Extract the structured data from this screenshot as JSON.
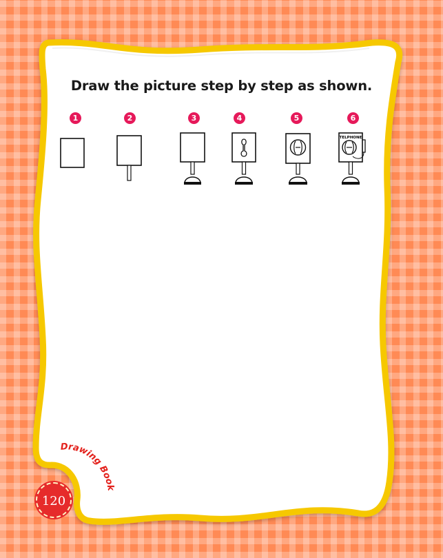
{
  "instruction": "Draw the picture step by step as shown.",
  "steps": [
    {
      "number": "1"
    },
    {
      "number": "2"
    },
    {
      "number": "3"
    },
    {
      "number": "4"
    },
    {
      "number": "5"
    },
    {
      "number": "6",
      "label": "TELPHONE"
    }
  ],
  "footer": {
    "brand": "Drawing Book",
    "page_number": "120"
  },
  "colors": {
    "background": "#ff8a55",
    "frame_border": "#f6c800",
    "badge": "#e6195a",
    "page_badge": "#e62b2b"
  }
}
